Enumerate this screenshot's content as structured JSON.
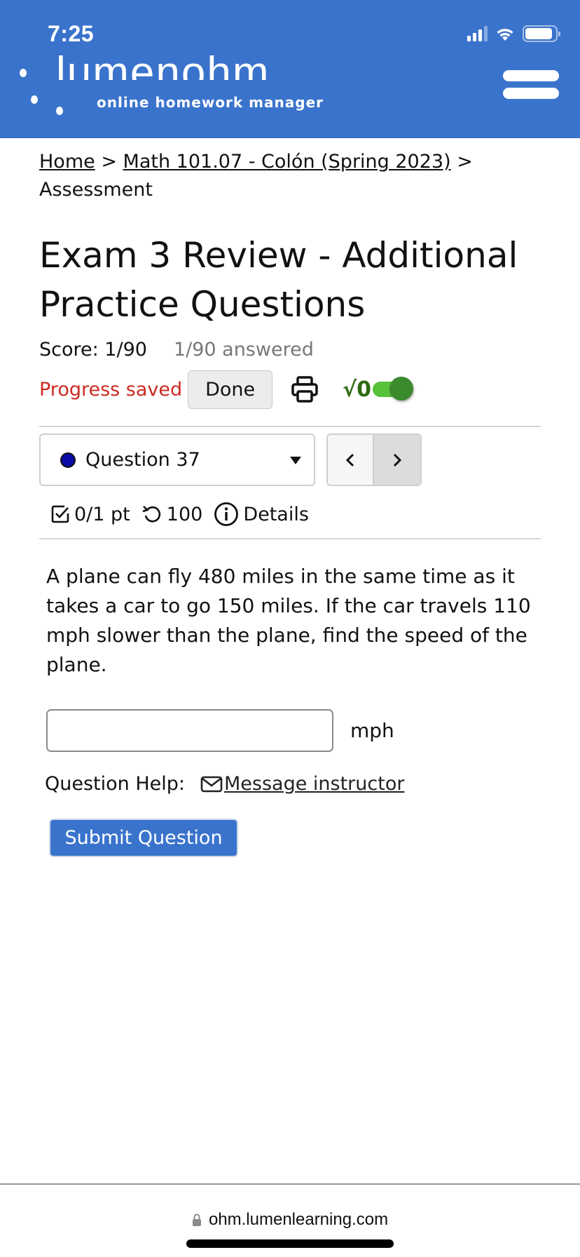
{
  "status_bar": {
    "time": "7:25"
  },
  "header": {
    "logo_word": "lumenohm",
    "logo_subtitle": "online homework manager",
    "brand_color": "#3a73cc"
  },
  "breadcrumb": {
    "home": "Home",
    "separator": ">",
    "course": "Math 101.07 - Colón (Spring 2023)",
    "current": "Assessment"
  },
  "assessment": {
    "title": "Exam 3 Review - Additional Practice Questions",
    "score": "Score: 1/90",
    "answered": "1/90 answered",
    "progress_status": "Progress saved",
    "done_label": "Done",
    "math_toggle_label": "√0",
    "math_toggle_on": true
  },
  "question_nav": {
    "selected_question": "Question 37",
    "prev_label": "‹",
    "next_label": "›"
  },
  "question_meta": {
    "points": "0/1 pt",
    "attempts": "100",
    "details_label": "Details"
  },
  "question": {
    "text": "A plane can fly 480 miles in the same time as it takes a car to go 150 miles. If the car travels 110 mph slower than the plane, find the speed of the plane.",
    "answer_value": "",
    "answer_placeholder": "",
    "unit": "mph",
    "help_label": "Question Help:",
    "message_link": "Message instructor",
    "submit_label": "Submit Question"
  },
  "browser": {
    "url": "ohm.lumenlearning.com"
  },
  "colors": {
    "accent": "#3a73cc",
    "error_text": "#cc2a22",
    "toggle_green": "#57c23a",
    "status_dot": "#0a0aa6"
  }
}
